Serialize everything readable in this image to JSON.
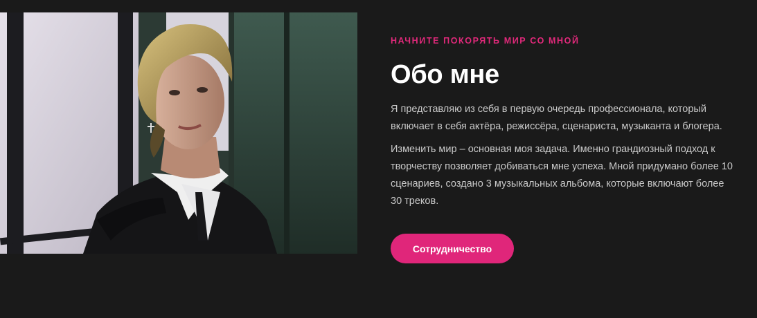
{
  "about": {
    "eyebrow": "НАЧНИТЕ ПОКОРЯТЬ МИР СО МНОЙ",
    "title": "Обо мне",
    "paragraph_1": "Я представляю из себя в первую очередь профессионала, который включает в себя актёра, режиссёра, сценариста, музыканта и блогера.",
    "paragraph_2": "Изменить мир – основная моя задача. Именно грандиозный подход к творчеству позволяет добиваться мне успеха. Мной придумано более 10 сценариев, создано 3 музыкальных альбома, которые включают более 30 треков.",
    "cta_label": "Сотрудничество"
  },
  "colors": {
    "background": "#1a1a1a",
    "accent": "#e0267a",
    "heading": "#ffffff",
    "body_text": "#c9c9c9"
  }
}
